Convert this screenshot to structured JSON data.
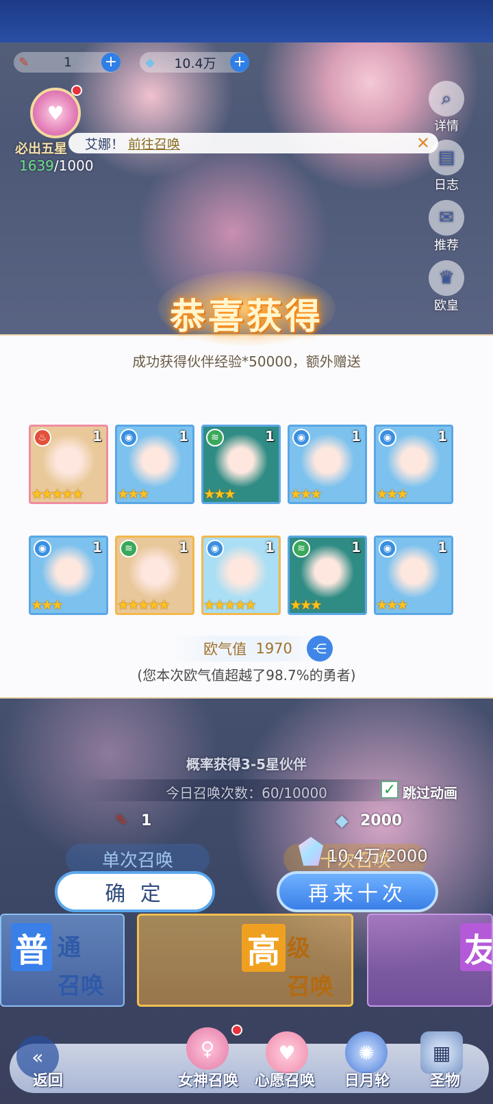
{
  "header": {
    "resources": [
      {
        "icon": "summon-ticket-icon",
        "value": "1"
      },
      {
        "icon": "crystal-icon",
        "value": "10.4万"
      }
    ],
    "guarantee": {
      "label": "必出五星",
      "progress_current": "1639",
      "progress_max": "/1000"
    },
    "notice": {
      "prefix": "艾娜！",
      "link": "前往召唤"
    },
    "side_buttons": [
      {
        "icon": "details-icon",
        "label": "详情"
      },
      {
        "icon": "log-icon",
        "label": "日志"
      },
      {
        "icon": "recommend-icon",
        "label": "推荐"
      },
      {
        "icon": "crown-icon",
        "label": "欧皇"
      }
    ]
  },
  "result": {
    "title": "恭喜获得",
    "subtitle": "成功获得伙伴经验*50000，额外赠送",
    "cards": [
      {
        "element": "fire",
        "level": "1",
        "stars": 5,
        "style": "pink",
        "color": "#e9c99a"
      },
      {
        "element": "water",
        "level": "1",
        "stars": 3,
        "style": "blue",
        "color": "#7dc2ee"
      },
      {
        "element": "wind",
        "level": "1",
        "stars": 3,
        "style": "blue",
        "color": "#2f8c84"
      },
      {
        "element": "water",
        "level": "1",
        "stars": 3,
        "style": "blue",
        "color": "#7dc2ee"
      },
      {
        "element": "water",
        "level": "1",
        "stars": 3,
        "style": "blue",
        "color": "#7dc2ee"
      },
      {
        "element": "water",
        "level": "1",
        "stars": 3,
        "style": "blue",
        "color": "#7dc2ee"
      },
      {
        "element": "wind",
        "level": "1",
        "stars": 5,
        "style": "gold",
        "color": "#e8c79a"
      },
      {
        "element": "water",
        "level": "1",
        "stars": 5,
        "style": "gold",
        "color": "#a9def4"
      },
      {
        "element": "wind",
        "level": "1",
        "stars": 3,
        "style": "blue",
        "color": "#2f8c84"
      },
      {
        "element": "water",
        "level": "1",
        "stars": 3,
        "style": "blue",
        "color": "#7dc2ee"
      }
    ],
    "luck_label": "欧气值",
    "luck_value": "1970",
    "luck_note": "(您本次欧气值超越了98.7%的勇者)"
  },
  "summon": {
    "probability_text": "概率获得3-5星伙伴",
    "today_count": "今日召唤次数：60/10000",
    "skip_animation": "跳过动画",
    "single_cost": "1",
    "ten_cost": "2000",
    "single_label": "单次召唤",
    "ten_label": "十次召唤",
    "crystal_balance": "10.4万/2000",
    "confirm_button": "确 定",
    "again_button": "再来十次"
  },
  "categories": [
    {
      "big": "普",
      "small1": "通",
      "small2": "召唤",
      "color": "#3a7fe8"
    },
    {
      "big": "高",
      "small1": "级",
      "small2": "召唤",
      "color": "#f0a020"
    },
    {
      "big": "友",
      "small1": "",
      "small2": "",
      "color": "#b45ad8"
    }
  ],
  "nav": [
    {
      "icon": "back-icon",
      "label": "返回"
    },
    {
      "icon": "goddess-summon-icon",
      "label": "女神召唤"
    },
    {
      "icon": "wish-summon-icon",
      "label": "心愿召唤"
    },
    {
      "icon": "sun-moon-wheel-icon",
      "label": "日月轮"
    },
    {
      "icon": "relic-icon",
      "label": "圣物"
    }
  ]
}
